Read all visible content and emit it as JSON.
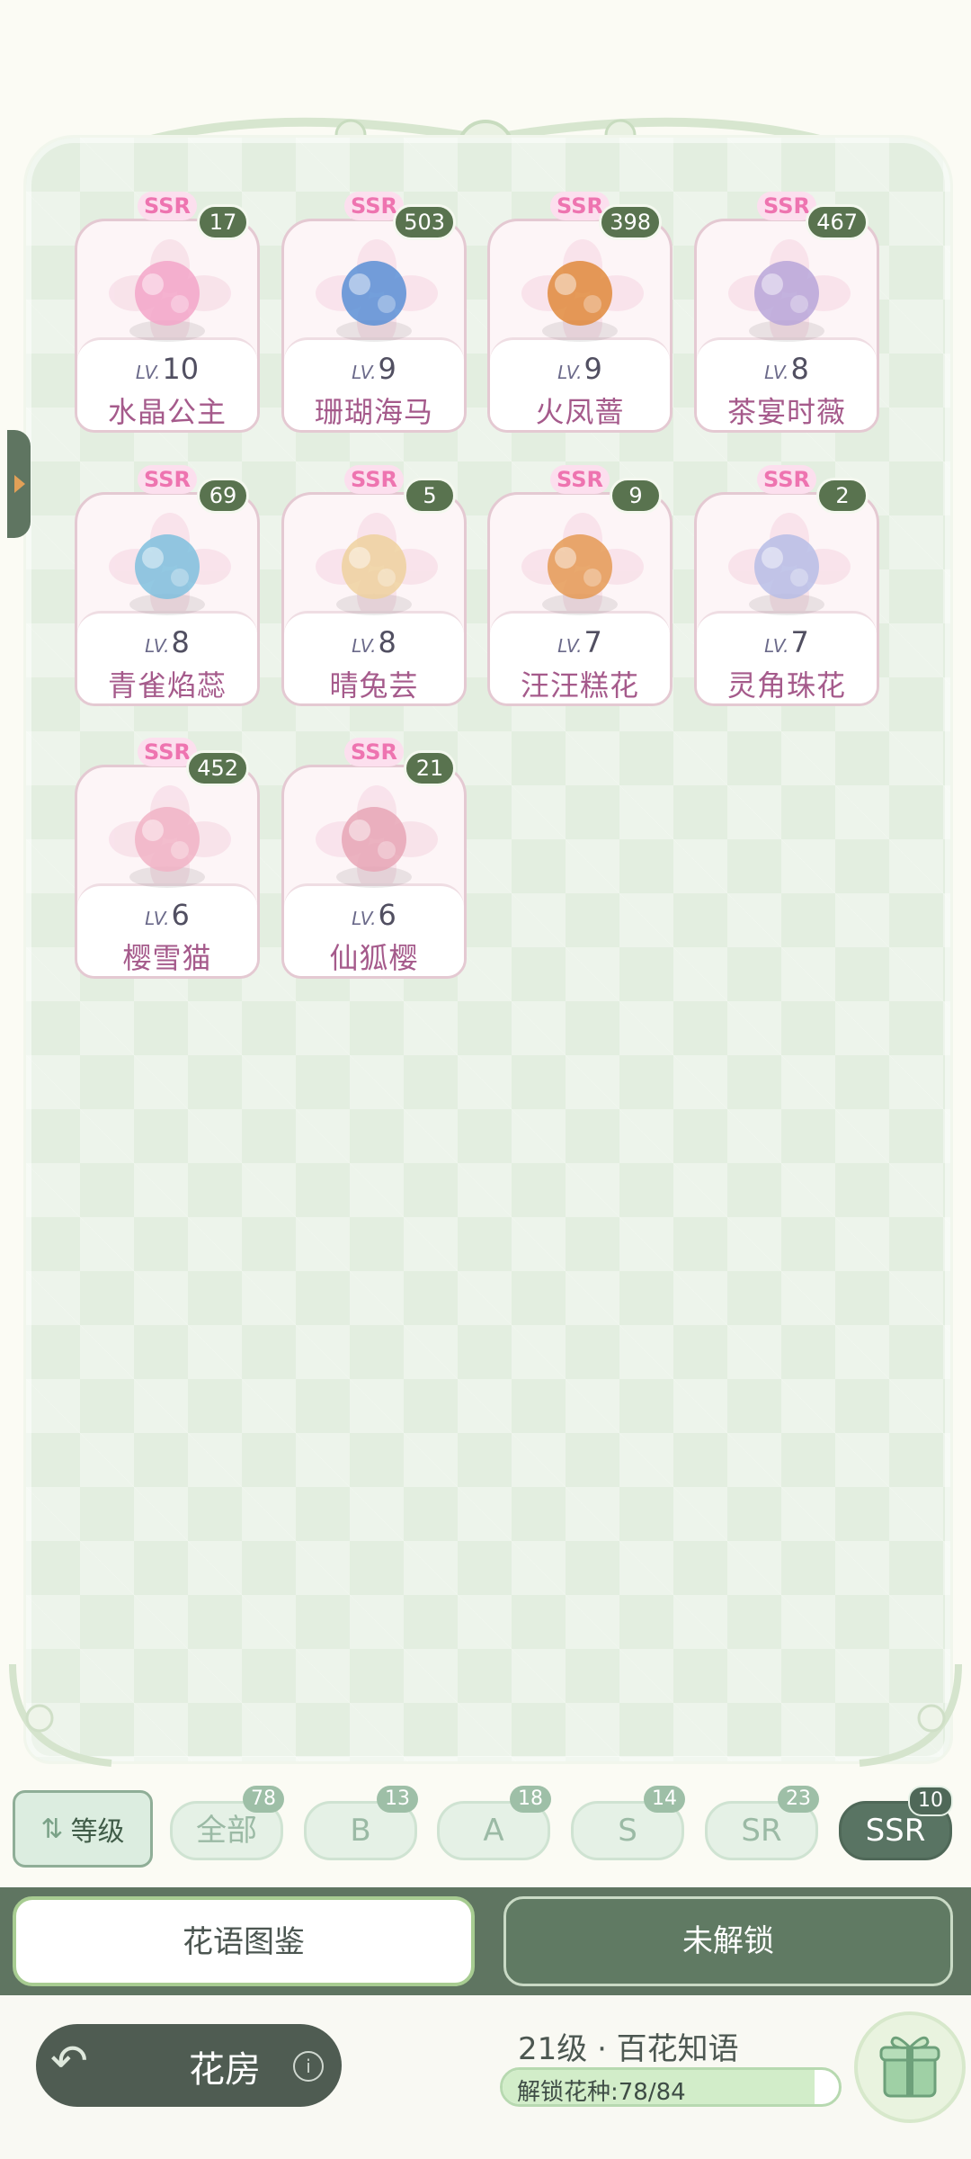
{
  "cards": [
    {
      "rarity": "SSR",
      "count": "17",
      "lv_prefix": "LV.",
      "lv": "10",
      "name": "水晶公主",
      "art_color": "#f3a6c9"
    },
    {
      "rarity": "SSR",
      "count": "503",
      "lv_prefix": "LV.",
      "lv": "9",
      "name": "珊瑚海马",
      "art_color": "#5b8fd6"
    },
    {
      "rarity": "SSR",
      "count": "398",
      "lv_prefix": "LV.",
      "lv": "9",
      "name": "火凤蔷",
      "art_color": "#e08a3c"
    },
    {
      "rarity": "SSR",
      "count": "467",
      "lv_prefix": "LV.",
      "lv": "8",
      "name": "茶宴时薇",
      "art_color": "#b9a6d9"
    },
    {
      "rarity": "SSR",
      "count": "69",
      "lv_prefix": "LV.",
      "lv": "8",
      "name": "青雀焰蕊",
      "art_color": "#7fc0de"
    },
    {
      "rarity": "SSR",
      "count": "5",
      "lv_prefix": "LV.",
      "lv": "8",
      "name": "晴兔芸",
      "art_color": "#efd19f"
    },
    {
      "rarity": "SSR",
      "count": "9",
      "lv_prefix": "LV.",
      "lv": "7",
      "name": "汪汪糕花",
      "art_color": "#e59a55"
    },
    {
      "rarity": "SSR",
      "count": "2",
      "lv_prefix": "LV.",
      "lv": "7",
      "name": "灵角珠花",
      "art_color": "#b7bde6"
    },
    {
      "rarity": "SSR",
      "count": "452",
      "lv_prefix": "LV.",
      "lv": "6",
      "name": "樱雪猫",
      "art_color": "#f1b3c6"
    },
    {
      "rarity": "SSR",
      "count": "21",
      "lv_prefix": "LV.",
      "lv": "6",
      "name": "仙狐樱",
      "art_color": "#e8a6b6"
    }
  ],
  "filters": {
    "sort_label": "等级",
    "pills": [
      {
        "label": "全部",
        "badge": "78"
      },
      {
        "label": "B",
        "badge": "13"
      },
      {
        "label": "A",
        "badge": "18"
      },
      {
        "label": "S",
        "badge": "14"
      },
      {
        "label": "SR",
        "badge": "23"
      },
      {
        "label": "SSR",
        "badge": "10"
      }
    ]
  },
  "tabs": {
    "left": "花语图鉴",
    "right": "未解锁"
  },
  "footer": {
    "home_label": "花房",
    "info": "i",
    "level_title": "21级 · 百花知语",
    "progress_text": "解锁花种:78/84",
    "progress_value": 0.9286
  }
}
